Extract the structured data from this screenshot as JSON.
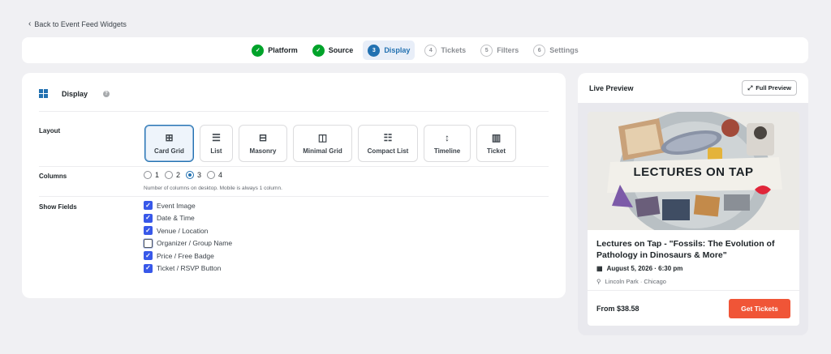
{
  "back_link": "Back to Event Feed Widgets",
  "steps": [
    {
      "num": "",
      "label": "Platform",
      "state": "done"
    },
    {
      "num": "",
      "label": "Source",
      "state": "done"
    },
    {
      "num": "3",
      "label": "Display",
      "state": "active"
    },
    {
      "num": "4",
      "label": "Tickets",
      "state": "todo"
    },
    {
      "num": "5",
      "label": "Filters",
      "state": "todo"
    },
    {
      "num": "6",
      "label": "Settings",
      "state": "todo"
    }
  ],
  "panel": {
    "title": "Display",
    "help": "?",
    "layout_label": "Layout",
    "layouts": [
      {
        "label": "Card Grid",
        "icon": "card-grid-icon",
        "selected": true
      },
      {
        "label": "List",
        "icon": "list-icon",
        "selected": false
      },
      {
        "label": "Masonry",
        "icon": "masonry-icon",
        "selected": false
      },
      {
        "label": "Minimal Grid",
        "icon": "minimal-grid-icon",
        "selected": false
      },
      {
        "label": "Compact List",
        "icon": "compact-list-icon",
        "selected": false
      },
      {
        "label": "Timeline",
        "icon": "timeline-icon",
        "selected": false
      },
      {
        "label": "Ticket",
        "icon": "ticket-icon",
        "selected": false
      }
    ],
    "columns_label": "Columns",
    "columns_options": [
      "1",
      "2",
      "3",
      "4"
    ],
    "columns_selected": "3",
    "columns_help": "Number of columns on desktop. Mobile is always 1 column.",
    "fields_label": "Show Fields",
    "fields": [
      {
        "label": "Event Image",
        "checked": true
      },
      {
        "label": "Date & Time",
        "checked": true
      },
      {
        "label": "Venue / Location",
        "checked": true
      },
      {
        "label": "Organizer / Group Name",
        "checked": false
      },
      {
        "label": "Price / Free Badge",
        "checked": true
      },
      {
        "label": "Ticket / RSVP Button",
        "checked": true
      }
    ]
  },
  "preview": {
    "title": "Live Preview",
    "full_preview": "Full Preview",
    "event": {
      "image_text": "LECTURES ON TAP",
      "title": "Lectures on Tap - \"Fossils: The Evolution of Pathology in Dinosaurs & More\"",
      "date": "August 5, 2026 · 6:30 pm",
      "location": "Lincoln Park · Chicago",
      "price": "From $38.58",
      "cta": "Get Tickets"
    }
  },
  "colors": {
    "accent": "#2271b1",
    "done": "#00a32a",
    "checkbox": "#3858e9",
    "cta": "#f05537"
  }
}
